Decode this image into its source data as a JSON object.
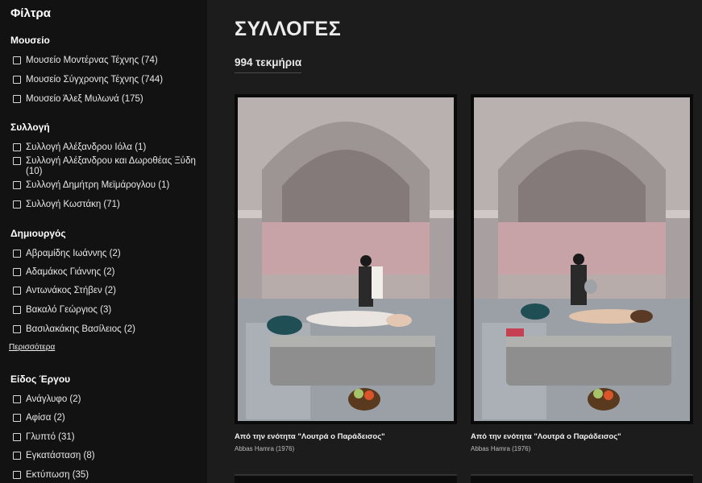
{
  "sidebar": {
    "title": "Φίλτρα",
    "more_link": "Περισσότερα",
    "groups": [
      {
        "title": "Μουσείο",
        "options": [
          "Μουσείο Μοντέρνας Τέχνης (74)",
          "Μουσείο Σύγχρονης Τέχνης (744)",
          "Μουσείο Άλεξ Μυλωνά (175)"
        ]
      },
      {
        "title": "Συλλογή",
        "options": [
          "Συλλογή Αλέξανδρου Ιόλα (1)",
          "Συλλογή Αλέξανδρου και Δωροθέας Ξύδη (10)",
          "Συλλογή Δημήτρη Μεϊμάρογλου (1)",
          "Συλλογή Κωστάκη (71)"
        ]
      },
      {
        "title": "Δημιουργός",
        "options": [
          "Αβραμίδης Ιωάννης (2)",
          "Αδαμάκος Γιάννης (2)",
          "Αντωνάκος Στήβεν (2)",
          "Βακαλό Γεώργιος (3)",
          "Βασιλακάκης Βασίλειος (2)"
        ]
      },
      {
        "title": "Είδος Έργου",
        "options": [
          "Ανάγλυφο (2)",
          "Αφίσα (2)",
          "Γλυπτό (31)",
          "Εγκατάσταση (8)",
          "Εκτύπωση (35)"
        ]
      }
    ]
  },
  "main": {
    "title": "ΣΥΛΛΟΓΕΣ",
    "count": "994 τεκμήρια",
    "cards": [
      {
        "caption": "Από την ενότητα \"Λουτρά ο Παράδεισος\"",
        "artist": "Abbas Hamra (1976)"
      },
      {
        "caption": "Από την ενότητα \"Λουτρά ο Παράδεισος\"",
        "artist": "Abbas Hamra (1976)"
      }
    ]
  }
}
